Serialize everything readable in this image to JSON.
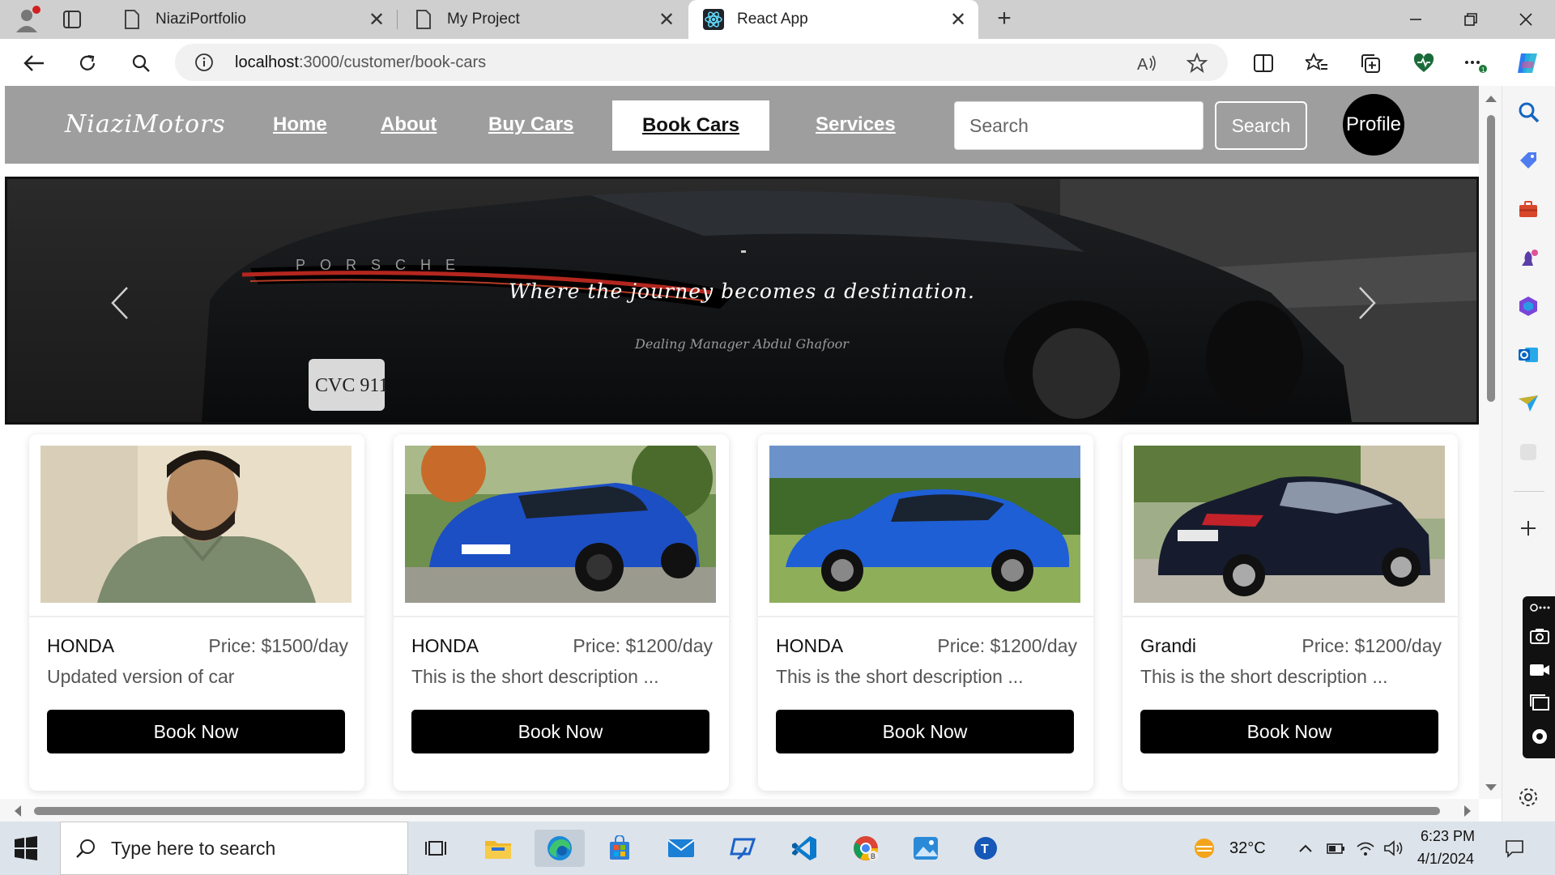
{
  "browser": {
    "tabs": [
      {
        "title": "NiaziPortfolio",
        "active": false
      },
      {
        "title": "My Project",
        "active": false
      },
      {
        "title": "React App",
        "active": true
      }
    ],
    "url_host": "localhost",
    "url_path": ":3000/customer/book-cars"
  },
  "site": {
    "brand": "NiaziMotors",
    "nav": [
      {
        "label": "Home"
      },
      {
        "label": "About"
      },
      {
        "label": "Buy Cars"
      },
      {
        "label": "Book Cars",
        "active": true
      },
      {
        "label": "Services"
      }
    ],
    "search_placeholder": "Search",
    "search_button": "Search",
    "profile_label": "Profile"
  },
  "hero": {
    "title": "Where the journey becomes a destination.",
    "subtitle": "Dealing Manager Abdul Ghafoor",
    "plate_text": "CVC 911",
    "car_badge": "PORSCHE"
  },
  "cards": [
    {
      "name": "HONDA",
      "price": "Price: $1500/day",
      "description": "Updated version of car",
      "button": "Book Now"
    },
    {
      "name": "HONDA",
      "price": "Price: $1200/day",
      "description": "This is the short description ...",
      "button": "Book Now"
    },
    {
      "name": "HONDA",
      "price": "Price: $1200/day",
      "description": "This is the short description ...",
      "button": "Book Now"
    },
    {
      "name": "Grandi",
      "price": "Price: $1200/day",
      "description": "This is the short description ...",
      "button": "Book Now"
    }
  ],
  "taskbar": {
    "search_placeholder": "Type here to search",
    "weather": "32°C",
    "time": "6:23 PM",
    "date": "4/1/2024"
  },
  "colors": {
    "navbar_bg": "#9e9e9e",
    "button_bg": "#000000",
    "accent_blue": "#1e5fd6"
  }
}
